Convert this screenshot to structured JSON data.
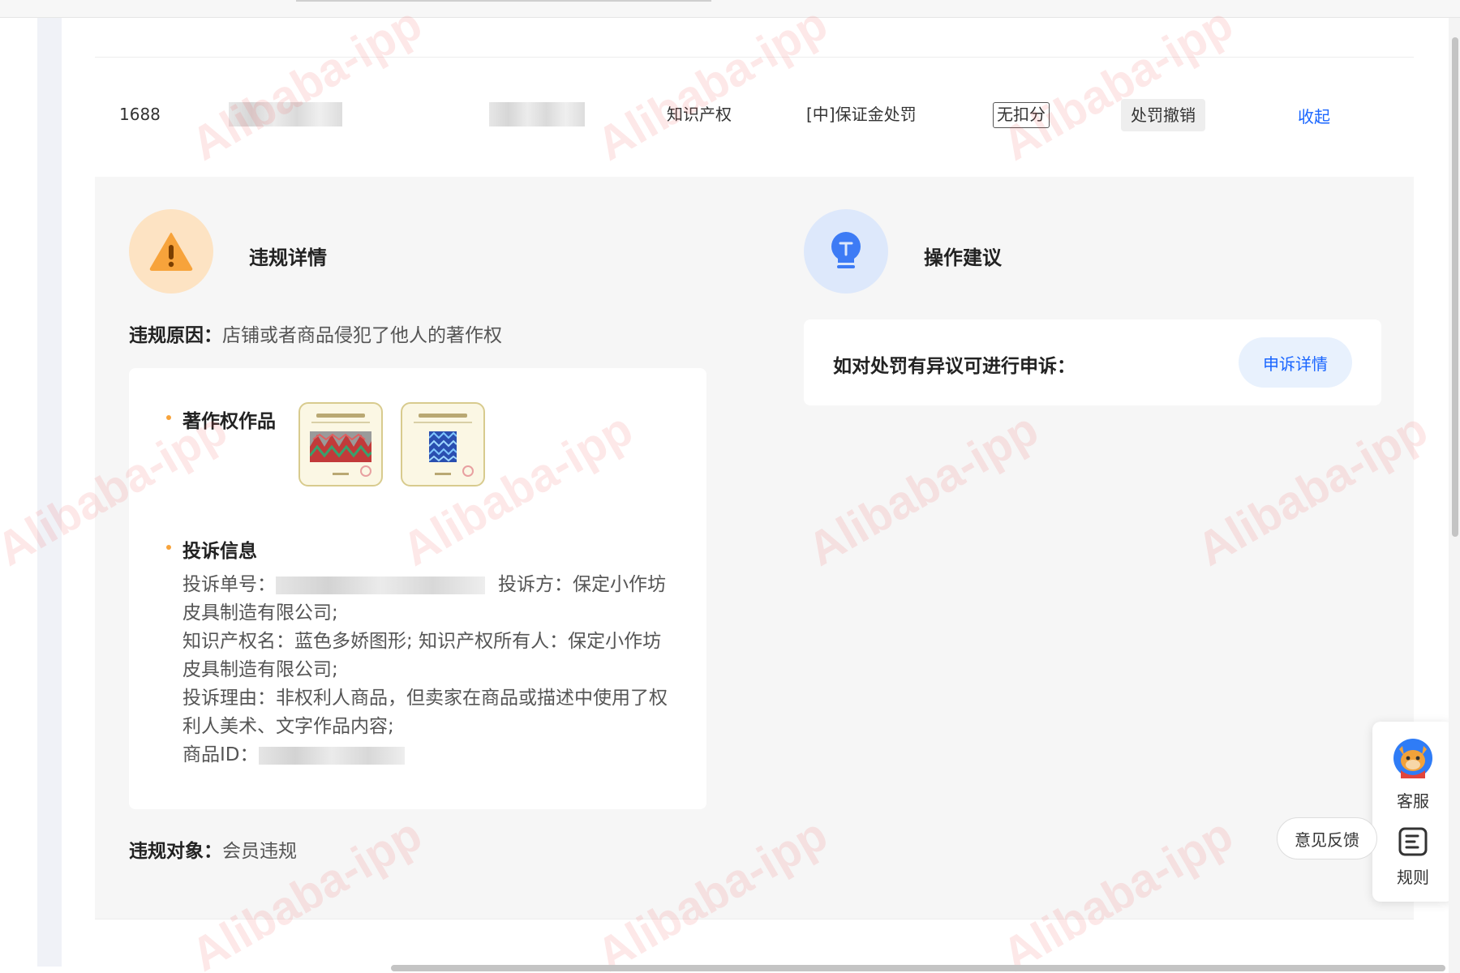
{
  "record": {
    "platform": "1688",
    "category": "知识产权",
    "penalty": "[中]保证金处罚",
    "score_tag": "无扣分",
    "status_tag": "处罚撤销",
    "collapse": "收起"
  },
  "violation": {
    "title": "违规详情",
    "reason_label": "违规原因：",
    "reason": "店铺或者商品侵犯了他人的著作权",
    "works_title": "著作权作品",
    "complaint_title": "投诉信息",
    "complaint_no_label": "投诉单号：",
    "complainant": "投诉方：保定小作坊皮具制造有限公司;",
    "ip_name": "知识产权名：蓝色多娇图形;",
    "ip_owner": "知识产权所有人：保定小作坊皮具制造有限公司;",
    "complaint_reason": "投诉理由：非权利人商品，但卖家在商品或描述中使用了权利人美术、文字作品内容;",
    "product_id_label": "商品ID：",
    "target_label": "违规对象：",
    "target": "会员违规"
  },
  "advice": {
    "title": "操作建议",
    "appeal_text": "如对处罚有异议可进行申诉：",
    "appeal_button": "申诉详情"
  },
  "toolbar": {
    "service": "客服",
    "rules": "规则",
    "feedback": "意见反馈"
  },
  "watermark": "Alibaba-ipp",
  "colors": {
    "link": "#1a66ff",
    "warn": "#f7a33b",
    "warn_bg": "#fde3c3",
    "bulb": "#3d7bf5",
    "bulb_bg": "#dde8fb"
  },
  "icons": [
    "warning-icon",
    "lightbulb-icon",
    "customer-service-icon",
    "rules-icon"
  ]
}
